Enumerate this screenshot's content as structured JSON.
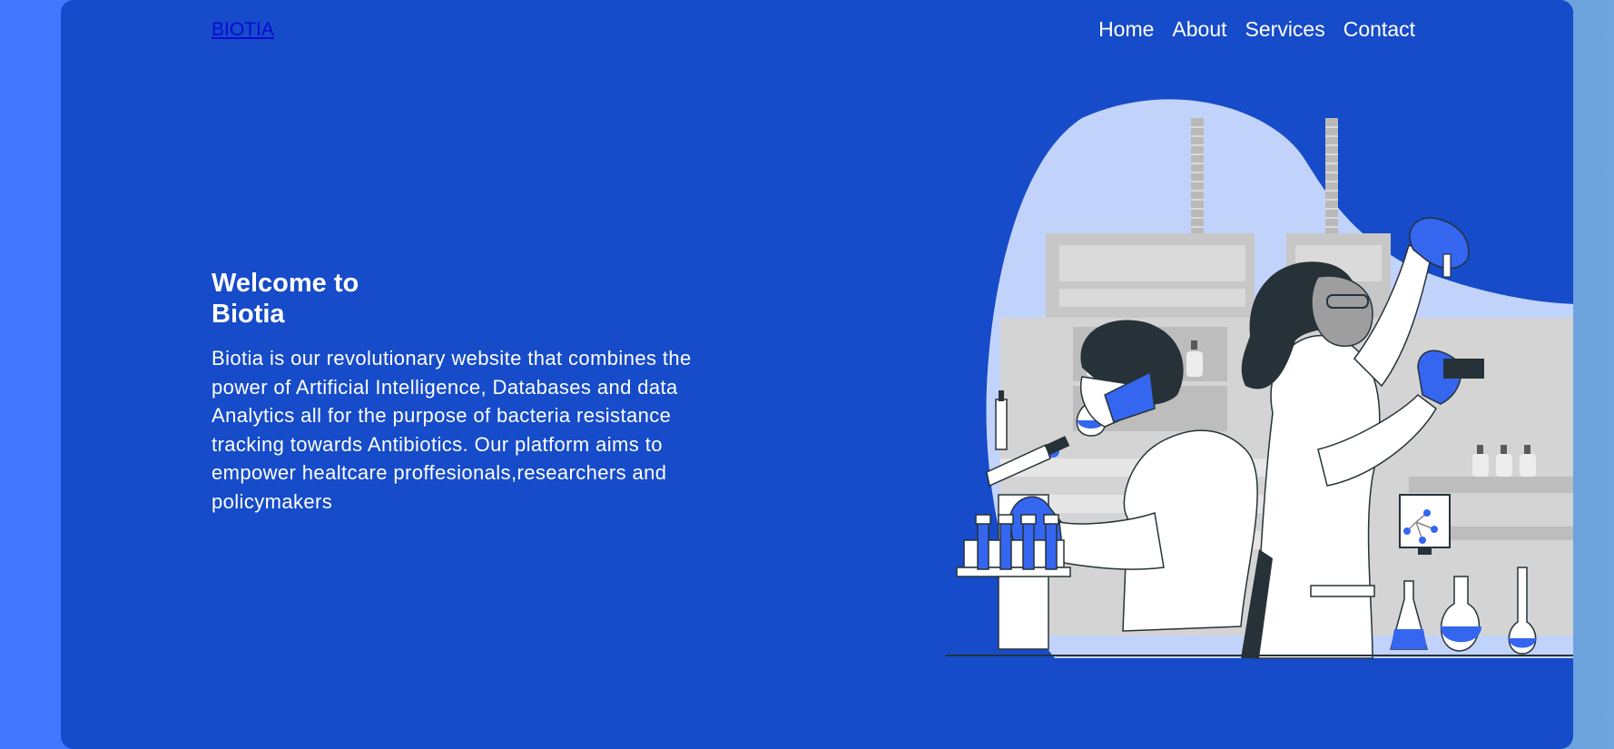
{
  "nav": {
    "logo": "BIOTIA",
    "links": [
      "Home",
      "About",
      "Services",
      "Contact"
    ]
  },
  "hero": {
    "title": "Welcome to Biotia",
    "description": "Biotia is our revolutionary website that combines the power of Artificial Intelligence, Databases and data Analytics all for the purpose of bacteria resistance tracking towards Antibiotics. Our platform aims to empower healtcare proffesionals,researchers and policymakers"
  },
  "illustration": {
    "subject": "scientists-in-laboratory"
  },
  "colors": {
    "page_background": "#164bc9",
    "outer_background": "#4178ff",
    "accent_blue": "#3566f0",
    "blob": "#c2d3fb",
    "dark_hair": "#263238"
  }
}
